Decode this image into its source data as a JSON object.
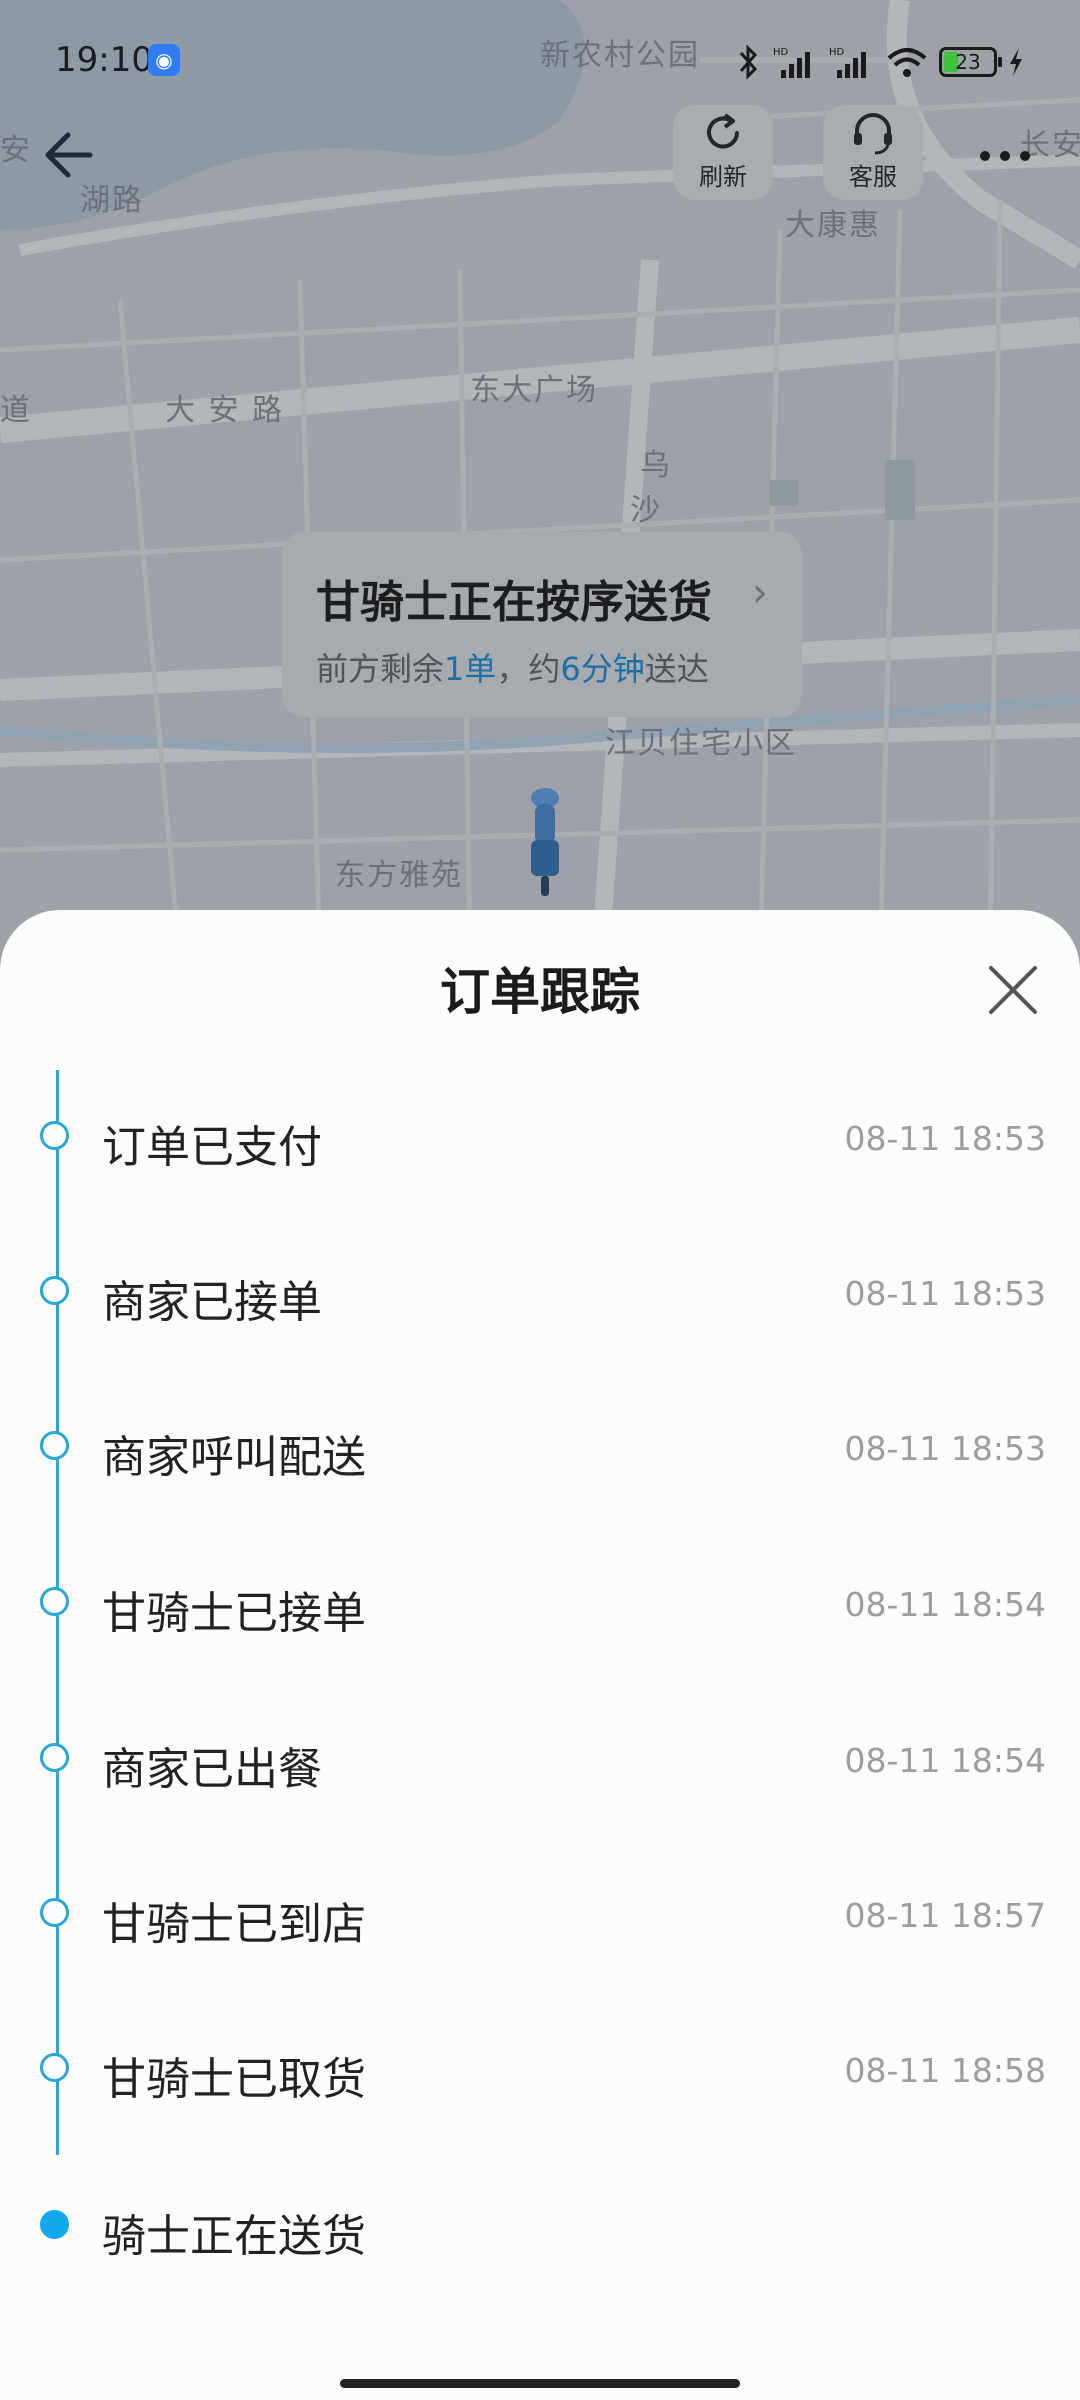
{
  "status_bar": {
    "time": "19:10",
    "battery": "23"
  },
  "map": {
    "labels": [
      "新农村公园",
      "安",
      "湖路",
      "大康惠",
      "长安",
      "道",
      "大 安 路",
      "东大广场",
      "乌",
      "沙",
      "江贝住宅小区",
      "东方雅苑"
    ]
  },
  "toolbar": {
    "refresh_label": "刷新",
    "service_label": "客服"
  },
  "bubble": {
    "title": "甘骑士正在按序送货",
    "sub_prefix": "前方剩余",
    "sub_orders": "1单",
    "sub_mid": "，约",
    "sub_minutes": "6分钟",
    "sub_suffix": "送达"
  },
  "sheet": {
    "title": "订单跟踪",
    "steps": [
      {
        "label": "订单已支付",
        "time": "08-11 18:53"
      },
      {
        "label": "商家已接单",
        "time": "08-11 18:53"
      },
      {
        "label": "商家呼叫配送",
        "time": "08-11 18:53"
      },
      {
        "label": "甘骑士已接单",
        "time": "08-11 18:54"
      },
      {
        "label": "商家已出餐",
        "time": "08-11 18:54"
      },
      {
        "label": "甘骑士已到店",
        "time": "08-11 18:57"
      },
      {
        "label": "甘骑士已取货",
        "time": "08-11 18:58"
      },
      {
        "label": "骑士正在送货",
        "time": ""
      }
    ]
  },
  "colors": {
    "accent": "#12a8ee",
    "timeline": "#2aa6d8",
    "highlight": "#1e6fa3"
  }
}
